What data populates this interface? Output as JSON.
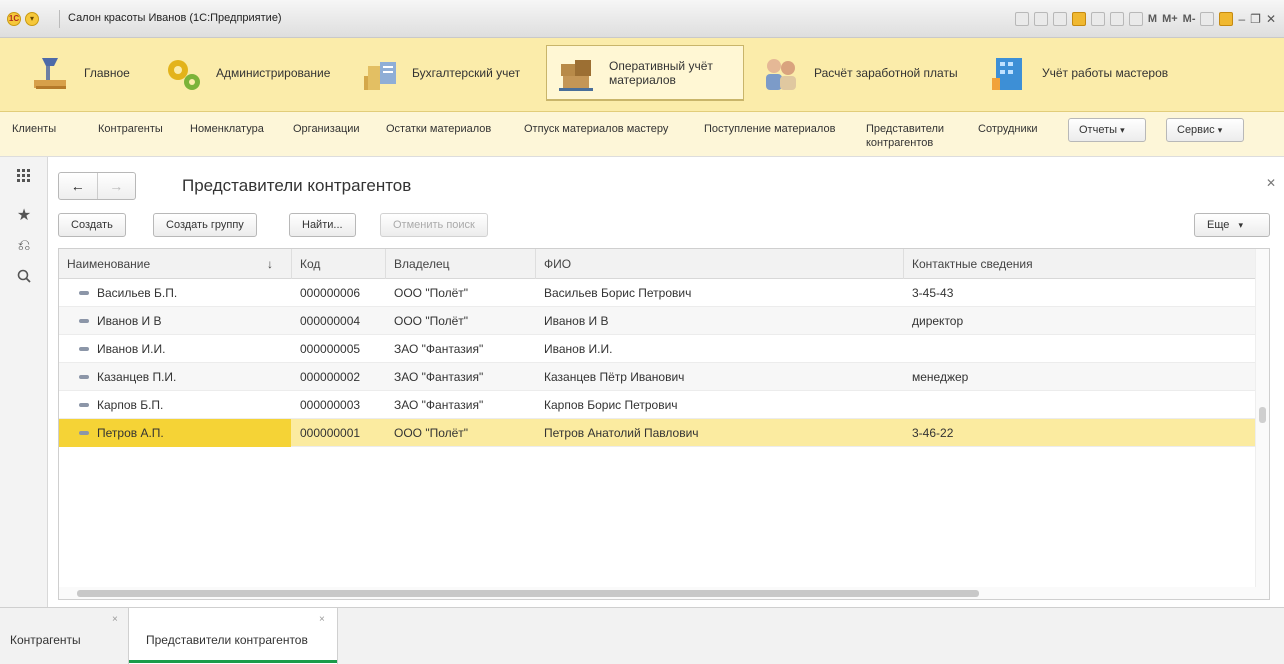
{
  "app": {
    "window_title": "Салон красоты Иванов  (1С:Предприятие)",
    "toolbar_labels": [
      "M",
      "M+",
      "M-"
    ],
    "colors": {
      "sections_bg": "#fbecaa",
      "selected_row": "#fbeba0",
      "selected_cell": "#f5d336",
      "active_tab_underline": "#1a9b4a"
    }
  },
  "sections": [
    {
      "label": "Главное",
      "icon": "desk-lamp-icon"
    },
    {
      "label": "Администрирование",
      "icon": "gears-icon"
    },
    {
      "label": "Бухгалтерский учет",
      "icon": "coins-icon"
    },
    {
      "label_line1": "Оперативный учёт",
      "label_line2": "материалов",
      "icon": "warehouse-boxes-icon",
      "active": true
    },
    {
      "label": "Расчёт заработной платы",
      "icon": "people-icon"
    },
    {
      "label": "Учёт работы мастеров",
      "icon": "building-icon"
    }
  ],
  "commands": {
    "links": [
      "Клиенты",
      "Контрагенты",
      "Номенклатура",
      "Организации",
      "Остатки материалов",
      "Отпуск материалов мастеру",
      "Поступление материалов"
    ],
    "link_rep_line1": "Представители",
    "link_rep_line2": "контрагентов",
    "link_staff": "Сотрудники",
    "reports_label": "Отчеты",
    "service_label": "Сервис"
  },
  "form": {
    "title": "Представители контрагентов",
    "buttons": {
      "create": "Создать",
      "create_group": "Создать группу",
      "find": "Найти...",
      "cancel_search": "Отменить поиск",
      "more": "Еще"
    },
    "columns": [
      "Наименование",
      "Код",
      "Владелец",
      "ФИО",
      "Контактные сведения"
    ],
    "rows": [
      {
        "name": "Васильев Б.П.",
        "code": "000000006",
        "owner": "ООО \"Полёт\"",
        "fio": "Васильев Борис Петрович",
        "contact": "3-45-43"
      },
      {
        "name": "Иванов И В",
        "code": "000000004",
        "owner": "ООО \"Полёт\"",
        "fio": "Иванов И В",
        "contact": "директор"
      },
      {
        "name": "Иванов И.И.",
        "code": "000000005",
        "owner": "ЗАО \"Фантазия\"",
        "fio": "Иванов И.И.",
        "contact": ""
      },
      {
        "name": "Казанцев П.И.",
        "code": "000000002",
        "owner": "ЗАО \"Фантазия\"",
        "fio": "Казанцев Пётр Иванович",
        "contact": "менеджер"
      },
      {
        "name": "Карпов Б.П.",
        "code": "000000003",
        "owner": "ЗАО \"Фантазия\"",
        "fio": "Карпов Борис Петрович",
        "contact": ""
      },
      {
        "name": "Петров А.П.",
        "code": "000000001",
        "owner": "ООО \"Полёт\"",
        "fio": "Петров Анатолий Павлович",
        "contact": "3-46-22"
      }
    ]
  },
  "bottom_tabs": [
    {
      "label": "Контрагенты"
    },
    {
      "label": "Представители контрагентов",
      "active": true
    }
  ]
}
